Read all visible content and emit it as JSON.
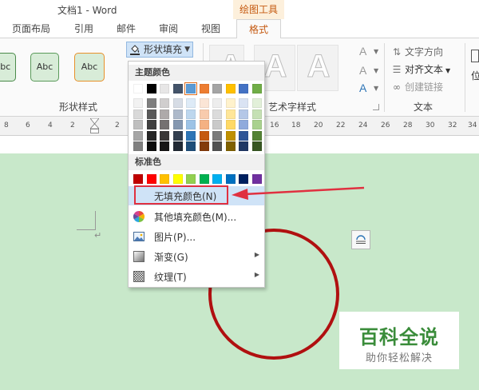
{
  "window": {
    "title": "文档1 - Word",
    "context_tab": "绘图工具"
  },
  "tabs": [
    {
      "label": "页面布局"
    },
    {
      "label": "引用"
    },
    {
      "label": "邮件"
    },
    {
      "label": "审阅"
    },
    {
      "label": "视图"
    },
    {
      "label": "格式",
      "active": true
    }
  ],
  "ribbon": {
    "shape_styles": {
      "buttons": [
        {
          "label": "Abc"
        },
        {
          "label": "Abc"
        },
        {
          "label": "Abc"
        }
      ],
      "fill_button": "形状填充",
      "group_label": "形状样式"
    },
    "art_styles": {
      "letter": "A",
      "group_label": "艺术字样式"
    },
    "text_group": {
      "text_direction": "文字方向",
      "align_text": "对齐文本",
      "create_link": "创建链接",
      "group_label": "文本",
      "a_glyph": "A",
      "partial_right": "位"
    }
  },
  "ruler": {
    "ticks": [
      "8",
      "6",
      "4",
      "2",
      "2",
      "16",
      "18",
      "20",
      "22",
      "24",
      "26",
      "28",
      "30",
      "32",
      "34"
    ]
  },
  "menu": {
    "theme_colors_title": "主题颜色",
    "standard_colors_title": "标准色",
    "theme_top_row": [
      "#ffffff",
      "#000000",
      "#e7e6e6",
      "#44546a",
      "#5b9bd5",
      "#ed7d31",
      "#a5a5a5",
      "#ffc000",
      "#4472c4",
      "#70ad47"
    ],
    "theme_shades": [
      [
        "#f2f2f2",
        "#7f7f7f",
        "#d0cece",
        "#d6dce5",
        "#deebf7",
        "#fbe5d6",
        "#ededed",
        "#fff2cc",
        "#dae3f3",
        "#e2f0d9"
      ],
      [
        "#d9d9d9",
        "#595959",
        "#aeaaaa",
        "#adb9ca",
        "#bdd7ee",
        "#f8cbad",
        "#dbdbdb",
        "#ffe699",
        "#b4c7e7",
        "#c5e0b4"
      ],
      [
        "#bfbfbf",
        "#404040",
        "#757171",
        "#8497b0",
        "#9dc3e6",
        "#f4b183",
        "#c9c9c9",
        "#ffd966",
        "#8faadc",
        "#a9d18e"
      ],
      [
        "#a6a6a6",
        "#262626",
        "#3a3838",
        "#333f50",
        "#2e75b6",
        "#c55a11",
        "#7b7b7b",
        "#bf9000",
        "#2f5597",
        "#548235"
      ],
      [
        "#808080",
        "#0d0d0d",
        "#171616",
        "#222a35",
        "#1f4e79",
        "#843c0c",
        "#525252",
        "#7f6000",
        "#203864",
        "#385723"
      ]
    ],
    "standard_colors": [
      "#c00000",
      "#ff0000",
      "#ffc000",
      "#ffff00",
      "#92d050",
      "#00b050",
      "#00b0f0",
      "#0070c0",
      "#002060",
      "#7030a0"
    ],
    "items": [
      {
        "label": "无填充颜色(N)"
      },
      {
        "label": "其他填充颜色(M)..."
      },
      {
        "label": "图片(P)..."
      },
      {
        "label": "渐变(G)"
      },
      {
        "label": "纹理(T)"
      }
    ]
  },
  "document": {
    "paragraph_mark": "↵",
    "circle_color": "#b01010"
  },
  "watermark": {
    "title": "百科全说",
    "subtitle": "助你轻松解决"
  }
}
